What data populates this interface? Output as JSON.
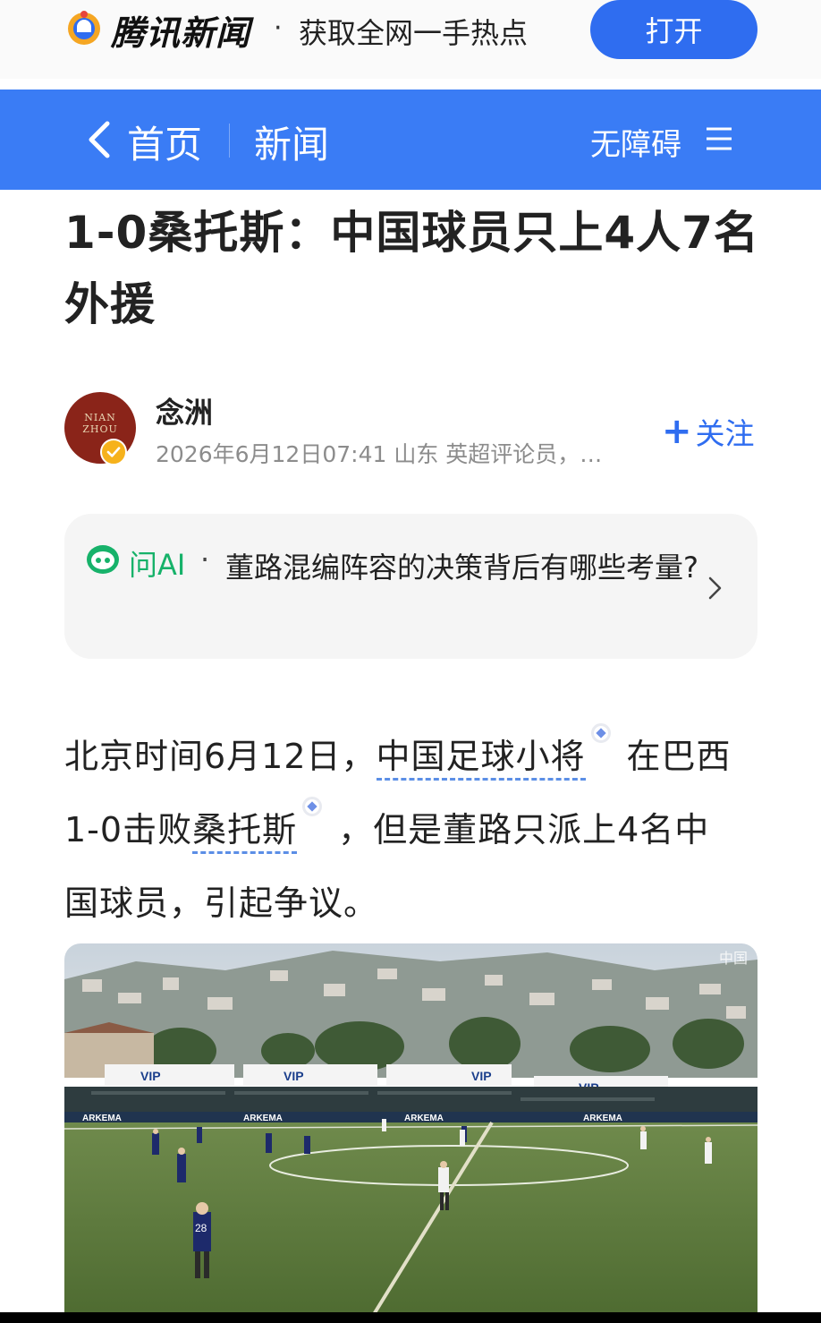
{
  "promo": {
    "brand": "腾讯新闻",
    "separator": "·",
    "slogan": "获取全网一手热点",
    "open_label": "打开"
  },
  "nav": {
    "home": "首页",
    "section": "新闻",
    "accessibility": "无障碍",
    "back_icon": "chevron-left-icon",
    "menu_icon": "hamburger-icon",
    "bar_color": "#3a7cf5"
  },
  "article": {
    "title": "1-0桑托斯：中国球员只上4人7名外援",
    "author": {
      "name": "念洲",
      "avatar_text_line1": "NIAN",
      "avatar_text_line2": "ZHOU",
      "meta": "2026年6月12日07:41  山东  英超评论员，…",
      "follow_label": "关注"
    },
    "ask_ai": {
      "label": "问AI",
      "separator": "·",
      "question": "董路混编阵容的决策背后有哪些考量?"
    },
    "body": {
      "part1": "北京时间6月12日，",
      "entity1": "中国足球小将",
      "part2": "在巴西1-0击败",
      "entity2": "桑托斯",
      "part3": "，但是董路只派上4名中国球员，引起争议。"
    },
    "photo": {
      "watermark": "中国",
      "ads": [
        "VIP",
        "ARKEMA"
      ],
      "player_number": "28"
    }
  },
  "colors": {
    "accent": "#2f6df0",
    "ai_green": "#17b26a",
    "entity_underline": "#5b8ee6"
  }
}
